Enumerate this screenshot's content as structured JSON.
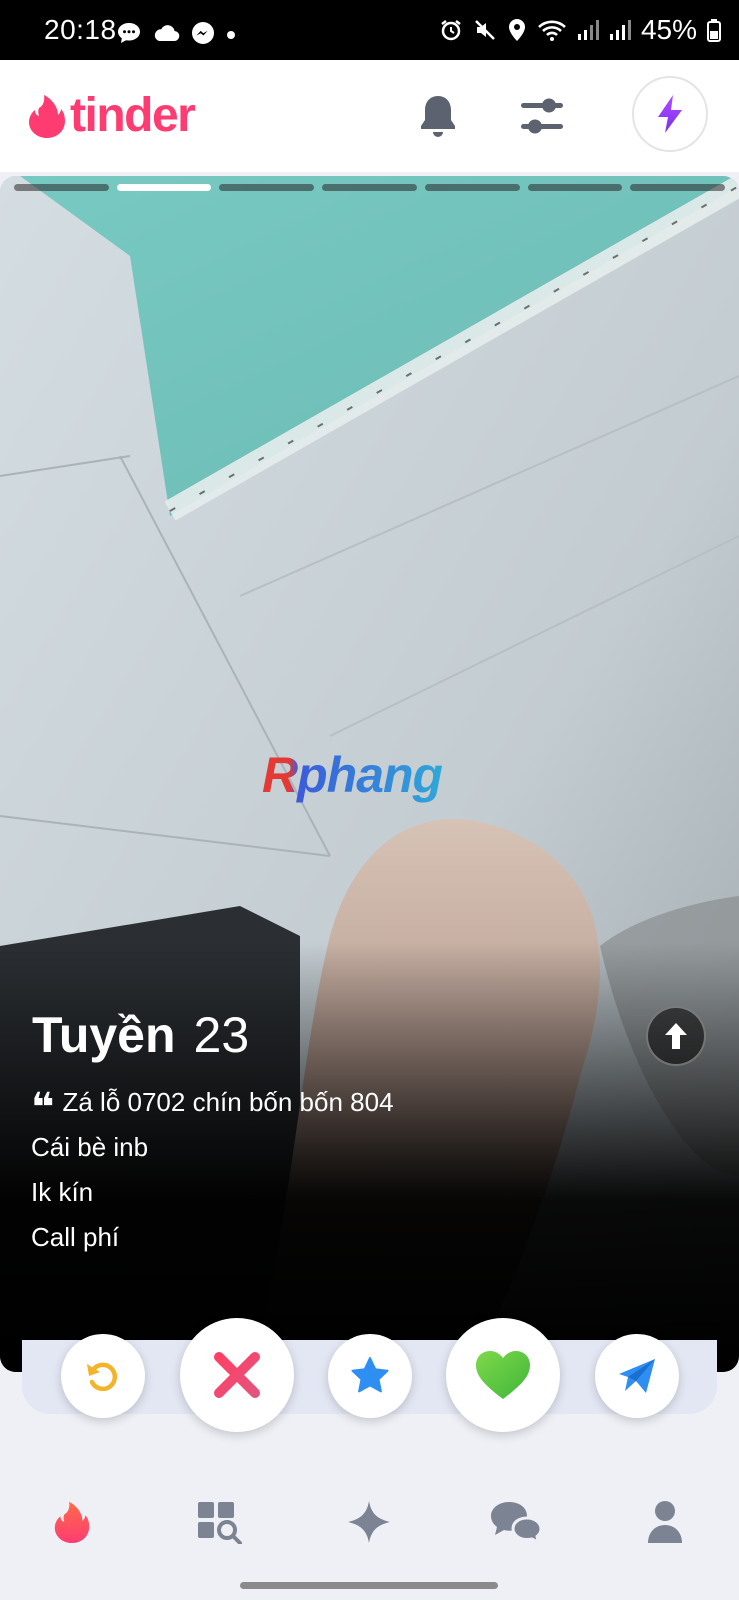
{
  "status_bar": {
    "time": "20:18",
    "battery": "45%",
    "left_icons": [
      "message-icon",
      "cloud-icon",
      "messenger-icon",
      "dot-icon"
    ],
    "right_icons": [
      "alarm-icon",
      "mute-icon",
      "location-icon",
      "wifi-icon",
      "signal-icon",
      "signal-icon",
      "battery-icon"
    ]
  },
  "header": {
    "logo_text": "tinder",
    "icons": [
      "bell-icon",
      "filter-sliders-icon",
      "boost-lightning-icon"
    ]
  },
  "card": {
    "photo_count": 7,
    "active_photo_index": 1,
    "watermark_text": "Rphang",
    "name": "Tuyền",
    "age": "23",
    "bio_lines": [
      "Zá lỗ 0702 chín bốn bốn 804",
      "Cái bè inb",
      "Ik kín",
      "Call phí"
    ]
  },
  "actions": [
    {
      "name": "rewind",
      "icon": "rewind-icon",
      "color": "#f4b42a"
    },
    {
      "name": "nope",
      "icon": "x-icon",
      "color": "#e8455f"
    },
    {
      "name": "super-like",
      "icon": "star-icon",
      "color": "#2e8ef2"
    },
    {
      "name": "like",
      "icon": "heart-icon",
      "color": "#4fc230"
    },
    {
      "name": "boost-message",
      "icon": "paper-plane-icon",
      "color": "#2e8ef2"
    }
  ],
  "bottom_nav": [
    {
      "name": "discover",
      "icon": "flame-icon",
      "active": true
    },
    {
      "name": "explore",
      "icon": "explore-grid-icon",
      "active": false
    },
    {
      "name": "gold",
      "icon": "sparkle-icon",
      "active": false
    },
    {
      "name": "chats",
      "icon": "chat-bubbles-icon",
      "active": false
    },
    {
      "name": "profile",
      "icon": "person-icon",
      "active": false
    }
  ],
  "colors": {
    "brand": "#fe3c72",
    "boost_purple": "#8a3ffc",
    "nav_inactive": "#7c8493"
  }
}
